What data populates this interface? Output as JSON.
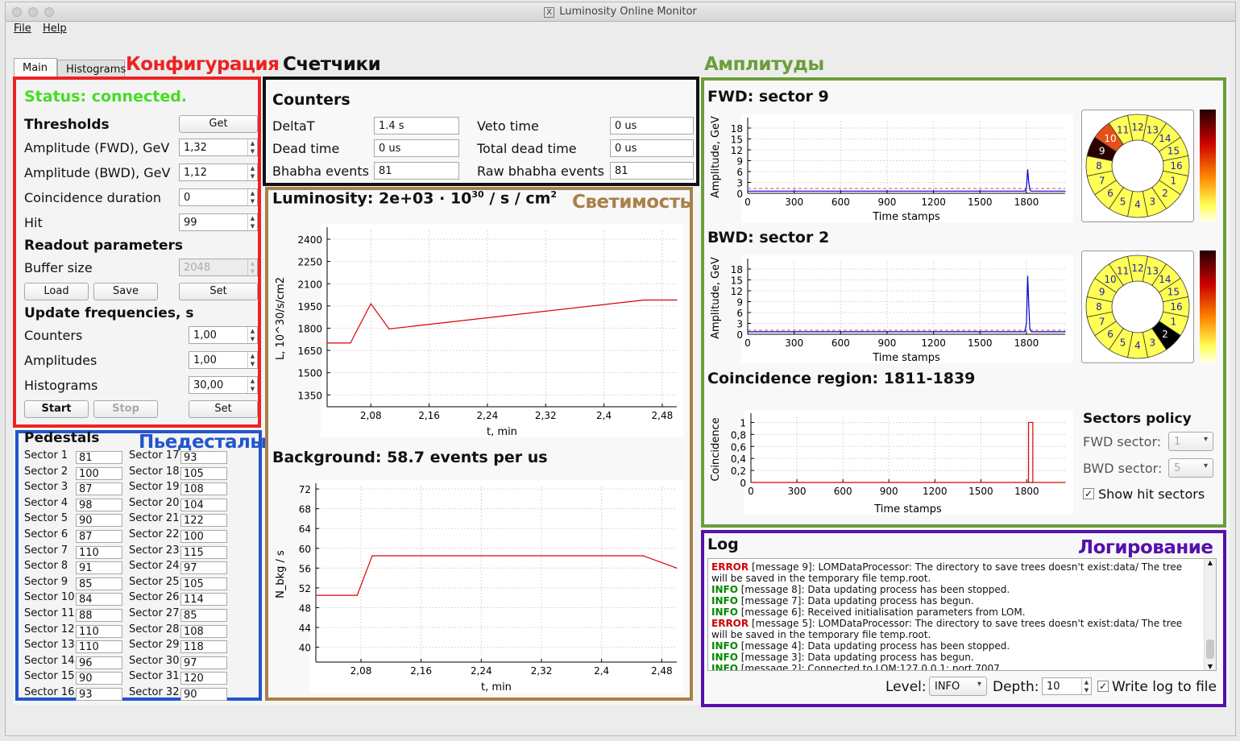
{
  "window": {
    "title": "Luminosity Online Monitor"
  },
  "menu": {
    "file": "File",
    "help": "Help"
  },
  "tabs": {
    "main": "Main",
    "histograms": "Histograms"
  },
  "annotations": {
    "config": "Конфигурация",
    "counters": "Счетчики",
    "amplitudes": "Амплитуды",
    "luminosity": "Светимость",
    "pedestals": "Пьедесталы",
    "logging": "Логирование",
    "colors": {
      "config": "#ee2222",
      "counters": "#111111",
      "amplitudes": "#6b9e3a",
      "luminosity": "#a9804a",
      "pedestals": "#2255cc",
      "logging": "#5511aa"
    }
  },
  "config": {
    "status": "Status: connected.",
    "status_color": "#44dd22",
    "thresholds_label": "Thresholds",
    "get_button": "Get",
    "amp_fwd_label": "Amplitude (FWD), GeV",
    "amp_fwd_value": "1,32",
    "amp_bwd_label": "Amplitude (BWD), GeV",
    "amp_bwd_value": "1,12",
    "coinc_label": "Coincidence duration",
    "coinc_value": "0",
    "hit_label": "Hit",
    "hit_value": "99",
    "readout_label": "Readout parameters",
    "buffer_label": "Buffer size",
    "buffer_value": "2048",
    "load_button": "Load",
    "save_button": "Save",
    "set_button": "Set",
    "update_label": "Update frequencies, s",
    "counters_label": "Counters",
    "counters_value": "1,00",
    "amplitudes_label": "Amplitudes",
    "amplitudes_value": "1,00",
    "histograms_label": "Histograms",
    "histograms_value": "30,00",
    "start_button": "Start",
    "stop_button": "Stop",
    "set2_button": "Set"
  },
  "pedestals": {
    "title": "Pedestals",
    "left": [
      {
        "label": "Sector 1",
        "value": "81"
      },
      {
        "label": "Sector 2",
        "value": "100"
      },
      {
        "label": "Sector 3",
        "value": "87"
      },
      {
        "label": "Sector 4",
        "value": "98"
      },
      {
        "label": "Sector 5",
        "value": "90"
      },
      {
        "label": "Sector 6",
        "value": "87"
      },
      {
        "label": "Sector 7",
        "value": "110"
      },
      {
        "label": "Sector 8",
        "value": "91"
      },
      {
        "label": "Sector 9",
        "value": "85"
      },
      {
        "label": "Sector 10",
        "value": "84"
      },
      {
        "label": "Sector 11",
        "value": "88"
      },
      {
        "label": "Sector 12",
        "value": "110"
      },
      {
        "label": "Sector 13",
        "value": "110"
      },
      {
        "label": "Sector 14",
        "value": "96"
      },
      {
        "label": "Sector 15",
        "value": "90"
      },
      {
        "label": "Sector 16",
        "value": "93"
      }
    ],
    "right": [
      {
        "label": "Sector 17",
        "value": "93"
      },
      {
        "label": "Sector 18",
        "value": "105"
      },
      {
        "label": "Sector 19",
        "value": "108"
      },
      {
        "label": "Sector 20",
        "value": "104"
      },
      {
        "label": "Sector 21",
        "value": "122"
      },
      {
        "label": "Sector 22",
        "value": "100"
      },
      {
        "label": "Sector 23",
        "value": "115"
      },
      {
        "label": "Sector 24",
        "value": "97"
      },
      {
        "label": "Sector 25",
        "value": "105"
      },
      {
        "label": "Sector 26",
        "value": "114"
      },
      {
        "label": "Sector 27",
        "value": "85"
      },
      {
        "label": "Sector 28",
        "value": "108"
      },
      {
        "label": "Sector 29",
        "value": "118"
      },
      {
        "label": "Sector 30",
        "value": "97"
      },
      {
        "label": "Sector 31",
        "value": "120"
      },
      {
        "label": "Sector 32",
        "value": "90"
      }
    ]
  },
  "counters": {
    "title": "Counters",
    "deltat_label": "DeltaT",
    "deltat_value": "1.4 s",
    "veto_label": "Veto time",
    "veto_value": "0 us",
    "dead_label": "Dead time",
    "dead_value": "0 us",
    "total_dead_label": "Total dead time",
    "total_dead_value": "0 us",
    "bhabha_label": "Bhabha events",
    "bhabha_value": "81",
    "raw_bhabha_label": "Raw bhabha events",
    "raw_bhabha_value": "81"
  },
  "luminosity": {
    "title": "Luminosity: 2e+03 · 10",
    "title_sup": "30",
    "title_tail": " / s / cm",
    "title_sup2": "2"
  },
  "background": {
    "title": "Background: 58.7 events per us"
  },
  "amplitudes": {
    "fwd_title": "FWD: sector 9",
    "bwd_title": "BWD: sector 2",
    "coinc_title": "Coincidence region: 1811-1839",
    "sectors_policy": "Sectors policy",
    "fwd_sector_label": "FWD sector:",
    "fwd_sector_value": "1",
    "bwd_sector_label": "BWD sector:",
    "bwd_sector_value": "5",
    "show_hit": "Show hit sectors",
    "show_hit_checked": true
  },
  "log": {
    "title": "Log",
    "entries": [
      {
        "level": "ERROR",
        "text": " [message 9]: LOMDataProcessor: The directory to save trees doesn't exist:data/ The tree"
      },
      {
        "level": "",
        "text": "will be saved in the temporary file temp.root."
      },
      {
        "level": "INFO",
        "text": " [message 8]: Data updating process has been stopped."
      },
      {
        "level": "INFO",
        "text": " [message 7]: Data updating process has begun."
      },
      {
        "level": "INFO",
        "text": " [message 6]: Received initialisation parameters from LOM."
      },
      {
        "level": "ERROR",
        "text": " [message 5]: LOMDataProcessor: The directory to save trees doesn't exist:data/ The tree"
      },
      {
        "level": "",
        "text": "will be saved in the temporary file temp.root."
      },
      {
        "level": "INFO",
        "text": " [message 4]: Data updating process has been stopped."
      },
      {
        "level": "INFO",
        "text": " [message 3]: Data updating process has begun."
      },
      {
        "level": "INFO",
        "text": " [message 2]: Connected to LOM:127.0.0.1: port 7007"
      }
    ],
    "level_label": "Level:",
    "level_value": "INFO",
    "depth_label": "Depth:",
    "depth_value": "10",
    "write_label": "Write log to file",
    "write_checked": true
  },
  "chart_data": [
    {
      "id": "luminosity",
      "type": "line",
      "xlabel": "t, min",
      "ylabel": "L, 10^30/s/cm2",
      "xlim": [
        2.02,
        2.5
      ],
      "ylim": [
        1270,
        2460
      ],
      "xticks": [
        2.08,
        2.16,
        2.24,
        2.32,
        2.4,
        2.48
      ],
      "xtick_labels": [
        "2,08",
        "2,16",
        "2,24",
        "2,32",
        "2,4",
        "2,48"
      ],
      "yticks": [
        1350,
        1500,
        1650,
        1800,
        1950,
        2100,
        2250,
        2400
      ],
      "x": [
        2.02,
        2.052,
        2.08,
        2.105,
        2.455,
        2.5
      ],
      "y": [
        1700,
        1700,
        1965,
        1795,
        1990,
        1990
      ],
      "color": "#dd0000"
    },
    {
      "id": "background",
      "type": "line",
      "xlabel": "t, min",
      "ylabel": "N_bkg / s",
      "xlim": [
        2.02,
        2.5
      ],
      "ylim": [
        37,
        72.5
      ],
      "xticks": [
        2.08,
        2.16,
        2.24,
        2.32,
        2.4,
        2.48
      ],
      "xtick_labels": [
        "2,08",
        "2,16",
        "2,24",
        "2,32",
        "2,4",
        "2,48"
      ],
      "yticks": [
        40,
        44,
        48,
        52,
        56,
        60,
        64,
        68,
        72
      ],
      "x": [
        2.02,
        2.075,
        2.095,
        2.455,
        2.5
      ],
      "y": [
        50.5,
        50.5,
        58.5,
        58.5,
        56
      ],
      "color": "#dd0000"
    },
    {
      "id": "fwd",
      "type": "line",
      "xlabel": "Time stamps",
      "ylabel": "Amplitude, GeV",
      "xlim": [
        0,
        2050
      ],
      "ylim": [
        0,
        20
      ],
      "xticks": [
        0,
        300,
        600,
        900,
        1200,
        1500,
        1800
      ],
      "yticks": [
        0,
        3,
        6,
        9,
        12,
        15,
        18
      ],
      "threshold": 1.32,
      "x": [
        0,
        1790,
        1800,
        1808,
        1815,
        1822,
        1830,
        2050
      ],
      "y": [
        0.6,
        0.6,
        1.5,
        6.5,
        3,
        1,
        0.6,
        0.6
      ],
      "color": "#0000cc"
    },
    {
      "id": "bwd",
      "type": "line",
      "xlabel": "Time stamps",
      "ylabel": "Amplitude, GeV",
      "xlim": [
        0,
        2050
      ],
      "ylim": [
        0,
        20
      ],
      "xticks": [
        0,
        300,
        600,
        900,
        1200,
        1500,
        1800
      ],
      "yticks": [
        0,
        3,
        6,
        9,
        12,
        15,
        18
      ],
      "threshold": 1.12,
      "x": [
        0,
        1790,
        1800,
        1808,
        1815,
        1822,
        1832,
        2050
      ],
      "y": [
        0.7,
        0.7,
        3,
        16,
        8,
        1.5,
        0.7,
        0.7
      ],
      "color": "#0000cc"
    },
    {
      "id": "coincidence",
      "type": "line",
      "xlabel": "Time stamps",
      "ylabel": "Coincidence",
      "xlim": [
        0,
        2050
      ],
      "ylim": [
        0,
        1.1
      ],
      "xticks": [
        0,
        300,
        600,
        900,
        1200,
        1500,
        1800
      ],
      "yticks": [
        0,
        0.2,
        0.4,
        0.6,
        0.8,
        1
      ],
      "ytick_labels": [
        "0",
        "0,2",
        "0,4",
        "0,6",
        "0,8",
        "1"
      ],
      "x": [
        0,
        1811,
        1811,
        1839,
        1839,
        2050
      ],
      "y": [
        0,
        0,
        1,
        1,
        0,
        0
      ],
      "color": "#dd0000"
    }
  ],
  "sector_wheels": {
    "fwd": {
      "order": [
        12,
        13,
        14,
        15,
        16,
        1,
        2,
        3,
        4,
        5,
        6,
        7,
        8,
        9,
        10,
        11
      ],
      "hot": {
        "9": "#2a0000",
        "10": "#e8501a"
      }
    },
    "bwd": {
      "order": [
        12,
        13,
        14,
        15,
        16,
        1,
        2,
        3,
        4,
        5,
        6,
        7,
        8,
        9,
        10,
        11
      ],
      "hot": {
        "2": "#000000"
      }
    },
    "base_color": "#ffff55"
  }
}
